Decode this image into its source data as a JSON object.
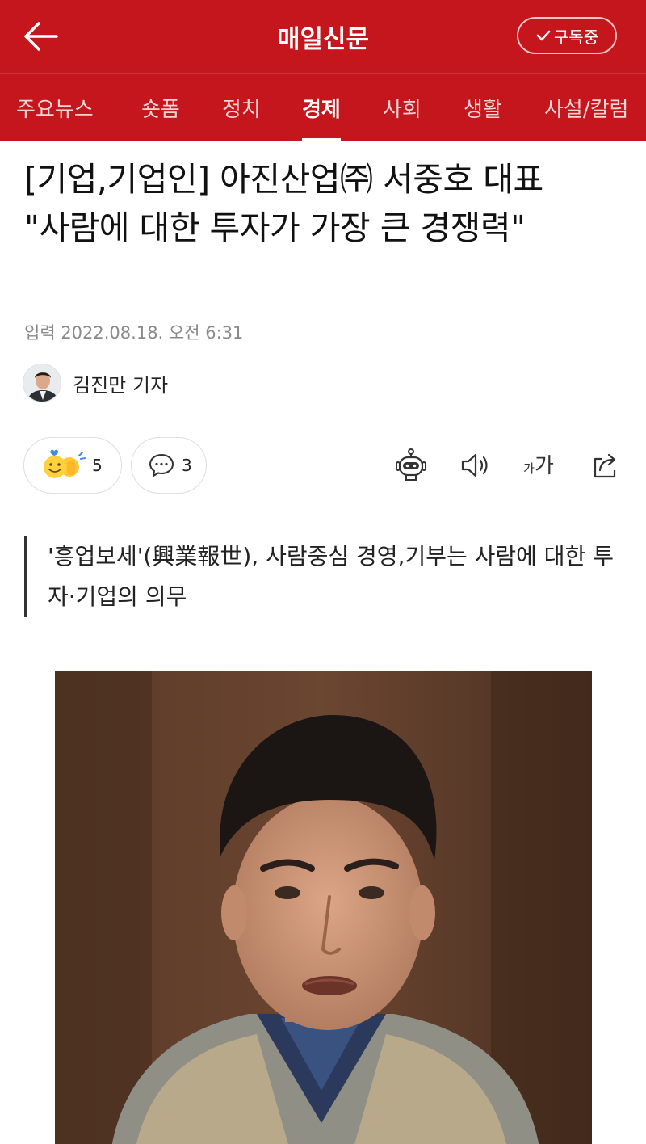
{
  "header": {
    "app_title": "매일신문",
    "subscribe_label": "구독중",
    "back_icon": "arrow-left-icon"
  },
  "tabs": [
    {
      "label": "주요뉴스",
      "active": false
    },
    {
      "label": "숏폼",
      "active": false
    },
    {
      "label": "정치",
      "active": false
    },
    {
      "label": "경제",
      "active": true
    },
    {
      "label": "사회",
      "active": false
    },
    {
      "label": "생활",
      "active": false
    },
    {
      "label": "사설/칼럼",
      "active": false
    }
  ],
  "article": {
    "headline": "[기업,기업인] 아진산업㈜ 서중호 대표 \"사람에 대한 투자가 가장 큰 경쟁력\"",
    "pubdate": "입력 2022.08.18. 오전 6:31",
    "reporter": "김진만 기자",
    "reactions": {
      "like_count": "5",
      "comment_count": "3"
    },
    "tools": [
      "summary-bot-icon",
      "speaker-icon",
      "font-size-icon",
      "share-icon"
    ],
    "font_size_label_small": "가",
    "font_size_label_large": "가",
    "summary": "'흥업보세'(興業報世), 사람중심 경영,기부는 사람에 대한 투자·기업의 의무"
  },
  "colors": {
    "brand_red": "#c4161c",
    "text": "#111111",
    "meta_gray": "#8a8a8a",
    "border_gray": "#dedede"
  }
}
